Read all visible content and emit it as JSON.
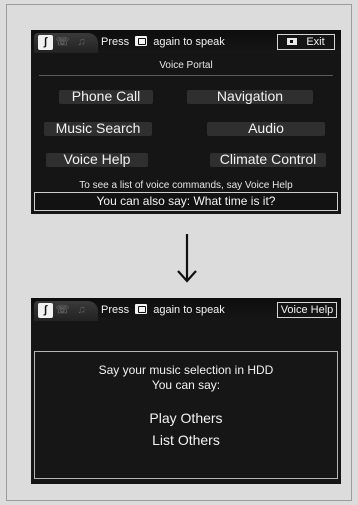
{
  "screen1": {
    "status_bar": {
      "mode_icons": [
        "voice-active-icon",
        "phone-dim-icon",
        "audio-dim-icon"
      ],
      "press_prefix": "Press",
      "press_suffix": "again to speak",
      "exit_label": "Exit"
    },
    "title": "Voice Portal",
    "menu": [
      {
        "label": "Phone Call"
      },
      {
        "label": "Navigation"
      },
      {
        "label": "Music Search"
      },
      {
        "label": "Audio"
      },
      {
        "label": "Voice Help"
      },
      {
        "label": "Climate Control"
      }
    ],
    "hint": "To see a list of voice commands, say Voice Help",
    "also_say": "You can also say: What time is it?"
  },
  "screen2": {
    "status_bar": {
      "press_prefix": "Press",
      "press_suffix": "again to speak",
      "voice_help_label": "Voice Help"
    },
    "line1": "Say your music selection in HDD",
    "line2": "You can say:",
    "option1": "Play Others",
    "option2": "List Others"
  },
  "colors": {
    "screen_bg": "#151515",
    "page_bg": "#dcdcdc",
    "text": "#f2f2f2"
  }
}
